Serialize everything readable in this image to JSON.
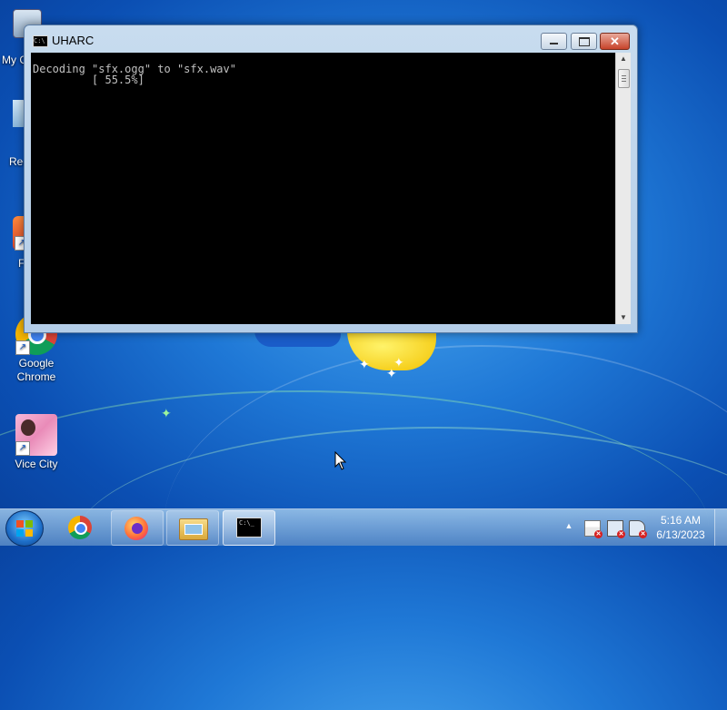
{
  "desktop": {
    "icons": [
      {
        "label": "My C",
        "icon": "computer-icon"
      },
      {
        "label": "Rec",
        "icon": "recycle-bin-icon"
      },
      {
        "label": "F",
        "icon": "app-shortcut-icon"
      },
      {
        "label": "Google Chrome",
        "icon": "chrome-icon"
      },
      {
        "label": "Vice City",
        "icon": "vice-city-icon"
      }
    ]
  },
  "window": {
    "title": "UHARC",
    "icon": "console-icon",
    "controls": {
      "minimize": "minimize-icon",
      "maximize": "maximize-icon",
      "close": "close-icon"
    }
  },
  "console": {
    "lines": [
      "Decoding \"sfx.ogg\" to \"sfx.wav\"",
      "         [ 55.5%]"
    ]
  },
  "taskbar": {
    "start_icon": "windows-start-icon",
    "items": [
      {
        "icon": "chrome-icon",
        "state": "pinned"
      },
      {
        "icon": "firefox-icon",
        "state": "pinned"
      },
      {
        "icon": "file-explorer-icon",
        "state": "pinned"
      },
      {
        "icon": "command-prompt-icon",
        "state": "active"
      }
    ],
    "tray": {
      "icons": [
        "show-hidden-icons-arrow",
        "action-center-flag-icon",
        "network-icon",
        "volume-muted-icon"
      ]
    },
    "clock": {
      "time": "5:16 AM",
      "date": "6/13/2023"
    }
  },
  "colors": {
    "console_bg": "#000000",
    "console_text": "#c0c0c0",
    "close_button": "#c7432a",
    "taskbar": "#5a8cc8"
  }
}
